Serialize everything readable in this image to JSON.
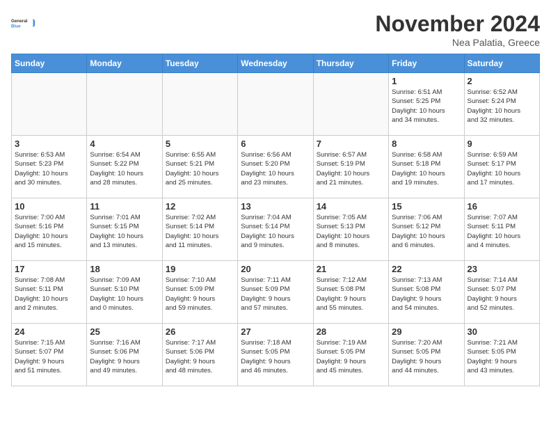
{
  "header": {
    "logo_line1": "General",
    "logo_line2": "Blue",
    "month": "November 2024",
    "location": "Nea Palatia, Greece"
  },
  "weekdays": [
    "Sunday",
    "Monday",
    "Tuesday",
    "Wednesday",
    "Thursday",
    "Friday",
    "Saturday"
  ],
  "weeks": [
    [
      {
        "day": "",
        "info": ""
      },
      {
        "day": "",
        "info": ""
      },
      {
        "day": "",
        "info": ""
      },
      {
        "day": "",
        "info": ""
      },
      {
        "day": "",
        "info": ""
      },
      {
        "day": "1",
        "info": "Sunrise: 6:51 AM\nSunset: 5:25 PM\nDaylight: 10 hours\nand 34 minutes."
      },
      {
        "day": "2",
        "info": "Sunrise: 6:52 AM\nSunset: 5:24 PM\nDaylight: 10 hours\nand 32 minutes."
      }
    ],
    [
      {
        "day": "3",
        "info": "Sunrise: 6:53 AM\nSunset: 5:23 PM\nDaylight: 10 hours\nand 30 minutes."
      },
      {
        "day": "4",
        "info": "Sunrise: 6:54 AM\nSunset: 5:22 PM\nDaylight: 10 hours\nand 28 minutes."
      },
      {
        "day": "5",
        "info": "Sunrise: 6:55 AM\nSunset: 5:21 PM\nDaylight: 10 hours\nand 25 minutes."
      },
      {
        "day": "6",
        "info": "Sunrise: 6:56 AM\nSunset: 5:20 PM\nDaylight: 10 hours\nand 23 minutes."
      },
      {
        "day": "7",
        "info": "Sunrise: 6:57 AM\nSunset: 5:19 PM\nDaylight: 10 hours\nand 21 minutes."
      },
      {
        "day": "8",
        "info": "Sunrise: 6:58 AM\nSunset: 5:18 PM\nDaylight: 10 hours\nand 19 minutes."
      },
      {
        "day": "9",
        "info": "Sunrise: 6:59 AM\nSunset: 5:17 PM\nDaylight: 10 hours\nand 17 minutes."
      }
    ],
    [
      {
        "day": "10",
        "info": "Sunrise: 7:00 AM\nSunset: 5:16 PM\nDaylight: 10 hours\nand 15 minutes."
      },
      {
        "day": "11",
        "info": "Sunrise: 7:01 AM\nSunset: 5:15 PM\nDaylight: 10 hours\nand 13 minutes."
      },
      {
        "day": "12",
        "info": "Sunrise: 7:02 AM\nSunset: 5:14 PM\nDaylight: 10 hours\nand 11 minutes."
      },
      {
        "day": "13",
        "info": "Sunrise: 7:04 AM\nSunset: 5:14 PM\nDaylight: 10 hours\nand 9 minutes."
      },
      {
        "day": "14",
        "info": "Sunrise: 7:05 AM\nSunset: 5:13 PM\nDaylight: 10 hours\nand 8 minutes."
      },
      {
        "day": "15",
        "info": "Sunrise: 7:06 AM\nSunset: 5:12 PM\nDaylight: 10 hours\nand 6 minutes."
      },
      {
        "day": "16",
        "info": "Sunrise: 7:07 AM\nSunset: 5:11 PM\nDaylight: 10 hours\nand 4 minutes."
      }
    ],
    [
      {
        "day": "17",
        "info": "Sunrise: 7:08 AM\nSunset: 5:11 PM\nDaylight: 10 hours\nand 2 minutes."
      },
      {
        "day": "18",
        "info": "Sunrise: 7:09 AM\nSunset: 5:10 PM\nDaylight: 10 hours\nand 0 minutes."
      },
      {
        "day": "19",
        "info": "Sunrise: 7:10 AM\nSunset: 5:09 PM\nDaylight: 9 hours\nand 59 minutes."
      },
      {
        "day": "20",
        "info": "Sunrise: 7:11 AM\nSunset: 5:09 PM\nDaylight: 9 hours\nand 57 minutes."
      },
      {
        "day": "21",
        "info": "Sunrise: 7:12 AM\nSunset: 5:08 PM\nDaylight: 9 hours\nand 55 minutes."
      },
      {
        "day": "22",
        "info": "Sunrise: 7:13 AM\nSunset: 5:08 PM\nDaylight: 9 hours\nand 54 minutes."
      },
      {
        "day": "23",
        "info": "Sunrise: 7:14 AM\nSunset: 5:07 PM\nDaylight: 9 hours\nand 52 minutes."
      }
    ],
    [
      {
        "day": "24",
        "info": "Sunrise: 7:15 AM\nSunset: 5:07 PM\nDaylight: 9 hours\nand 51 minutes."
      },
      {
        "day": "25",
        "info": "Sunrise: 7:16 AM\nSunset: 5:06 PM\nDaylight: 9 hours\nand 49 minutes."
      },
      {
        "day": "26",
        "info": "Sunrise: 7:17 AM\nSunset: 5:06 PM\nDaylight: 9 hours\nand 48 minutes."
      },
      {
        "day": "27",
        "info": "Sunrise: 7:18 AM\nSunset: 5:05 PM\nDaylight: 9 hours\nand 46 minutes."
      },
      {
        "day": "28",
        "info": "Sunrise: 7:19 AM\nSunset: 5:05 PM\nDaylight: 9 hours\nand 45 minutes."
      },
      {
        "day": "29",
        "info": "Sunrise: 7:20 AM\nSunset: 5:05 PM\nDaylight: 9 hours\nand 44 minutes."
      },
      {
        "day": "30",
        "info": "Sunrise: 7:21 AM\nSunset: 5:05 PM\nDaylight: 9 hours\nand 43 minutes."
      }
    ]
  ]
}
